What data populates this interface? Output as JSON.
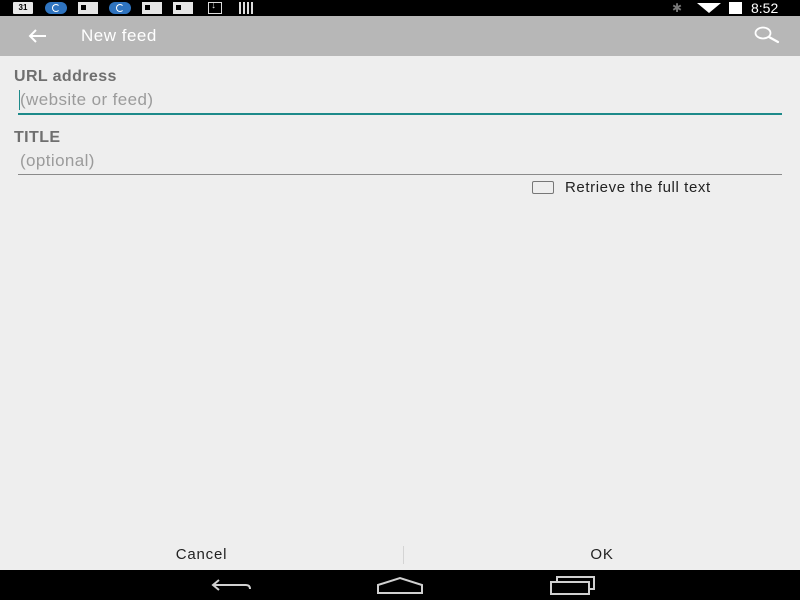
{
  "status_bar": {
    "calendar_icon_text": "31",
    "time": "8:52",
    "icons": [
      "calendar-icon",
      "sync-icon",
      "news-icon",
      "sync-icon",
      "news-icon",
      "news-icon",
      "download-icon",
      "barcode-icon",
      "bluetooth-icon",
      "wifi-icon",
      "battery-icon"
    ]
  },
  "action_bar": {
    "title": "New feed",
    "back_icon": "back-arrow-icon",
    "search_icon": "search-icon"
  },
  "form": {
    "url": {
      "label": "URL address",
      "value": "",
      "placeholder": "(website or feed)"
    },
    "title": {
      "label": "TITLE",
      "value": "",
      "placeholder": "(optional)"
    },
    "full_text": {
      "label": "Retrieve the full text",
      "checked": false
    }
  },
  "buttons": {
    "cancel": "Cancel",
    "ok": "OK"
  },
  "nav_bar": {
    "icons": [
      "nav-back-icon",
      "nav-home-icon",
      "nav-recents-icon"
    ]
  },
  "colors": {
    "action_bar": "#b7b7b7",
    "background": "#eeeeee",
    "focus_accent": "#1d8a8a",
    "system_bars": "#000000"
  }
}
